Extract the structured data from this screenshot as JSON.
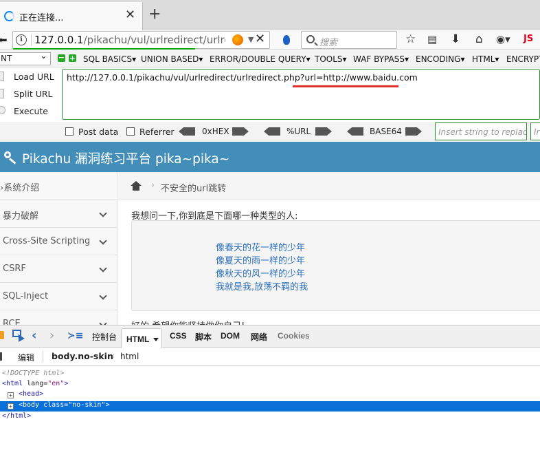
{
  "browser": {
    "tab_title": "正在连接...",
    "tab_close": "✕",
    "new_tab": "+",
    "url_host": "127.0.0.1",
    "url_path": "/pikachu/vul/urlredirect/urlredi",
    "search_placeholder": "搜索",
    "js_label": "JS"
  },
  "hackbar": {
    "select_value": "NT",
    "menus": [
      "SQL BASICS",
      "UNION BASED",
      "ERROR/DOUBLE QUERY",
      "TOOLS",
      "WAF BYPASS",
      "ENCODING",
      "HTML",
      "ENCRYPTION"
    ],
    "actions": [
      "Load URL",
      "Split URL",
      "Execute"
    ],
    "url_value": "http://127.0.0.1/pikachu/vul/urlredirect/urlredirect.php?url=http://www.baidu.com",
    "post_data_label": "Post data",
    "referrer_label": "Referrer",
    "encoders": [
      "0xHEX",
      "%URL",
      "BASE64"
    ],
    "replace_placeholder": "Insert string to replace",
    "replace_placeholder_2": "Ir"
  },
  "pikachu": {
    "site_title": "Pikachu 漏洞练习平台 pika~pika~",
    "sidebar_items": [
      "系统介绍",
      "暴力破解",
      "Cross-Site Scripting",
      "CSRF",
      "SQL-Inject",
      "RCE"
    ],
    "breadcrumb": "不安全的url跳转",
    "question": "我想问一下,你到底是下面哪一种类型的人:",
    "poem_lines": [
      "像春天的花一样的少年",
      "像夏天的雨一样的少年",
      "像秋天的风一样的少年",
      "我就是我,放荡不羁的我"
    ],
    "bottom_text": "好的,希望你能坚持做你自己!"
  },
  "devtools": {
    "tabs": [
      "控制台",
      "HTML",
      "CSS",
      "脚本",
      "DOM",
      "网络",
      "Cookies"
    ],
    "edit_label": "编辑",
    "crumb_body": "body.no-skin",
    "crumb_html": "html",
    "tree": {
      "doctype": "<!DOCTYPE html>",
      "html_open": "<html",
      "html_attr_name": "lang=",
      "html_attr_value": "\"en\"",
      "html_close_bracket": ">",
      "head": "<head>",
      "body_open": "<body",
      "body_attr_name": "class=",
      "body_attr_value": "\"no-skin\"",
      "body_close_bracket": ">",
      "html_close": "</html>"
    }
  }
}
